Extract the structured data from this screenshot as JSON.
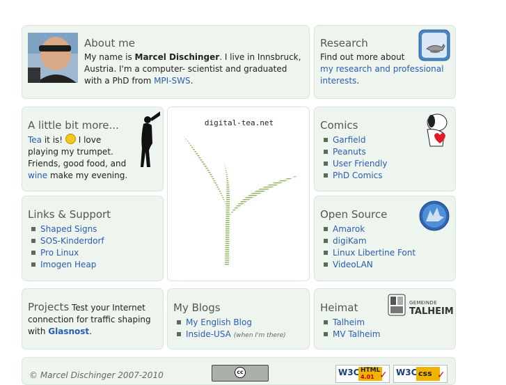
{
  "about": {
    "title": "About me",
    "text_before": "My name is ",
    "name": "Marcel Dischinger",
    "text_after": ". I live in Innsbruck, Austria. I'm a computer- scientist and graduated with a PhD from ",
    "link": "MPI-SWS",
    "end": "."
  },
  "research": {
    "title": "Research",
    "text": "Find out more about",
    "link": "my research and professional interests",
    "end": "."
  },
  "more": {
    "title": "A little bit more...",
    "tea": "Tea",
    "t1": " it is! ",
    "t2": " I love playing my trumpet. Friends, good food, and ",
    "wine": "wine",
    "t3": " make my evening."
  },
  "center": {
    "site": "digital-tea.net"
  },
  "comics": {
    "title": "Comics",
    "items": [
      "Garfield",
      "Peanuts",
      "User Friendly",
      "PhD Comics"
    ]
  },
  "links": {
    "title": "Links & Support",
    "items": [
      "Shaped Signs",
      "SOS-Kinderdorf",
      "Pro Linux",
      "Imogen Heap"
    ]
  },
  "opensource": {
    "title": "Open Source",
    "items": [
      "Amarok",
      "digiKam",
      "Linux Libertine Font",
      "VideoLAN"
    ]
  },
  "projects": {
    "title": "Projects",
    "text": " Test your Internet connection for traffic shaping with ",
    "link": "Glasnost",
    "end": "."
  },
  "blogs": {
    "title": "My Blogs",
    "item1": "My English Blog",
    "item2": "Inside-USA",
    "item2_note": "(when I'm there)"
  },
  "heimat": {
    "title": "Heimat",
    "items": [
      "Talheim",
      "MV Talheim"
    ],
    "logo_small": "GEMEINDE",
    "logo_big": "TALHEIM"
  },
  "footer": {
    "copyright": "© Marcel Dischinger 2007-2010",
    "cc": "cc",
    "w3c_html": "HTML",
    "w3c_html_ver": "4.01",
    "w3c_css": "css",
    "w3c": "W3C"
  },
  "colors": {
    "box_bg": "#eef5ef",
    "link": "#2a5db0"
  }
}
